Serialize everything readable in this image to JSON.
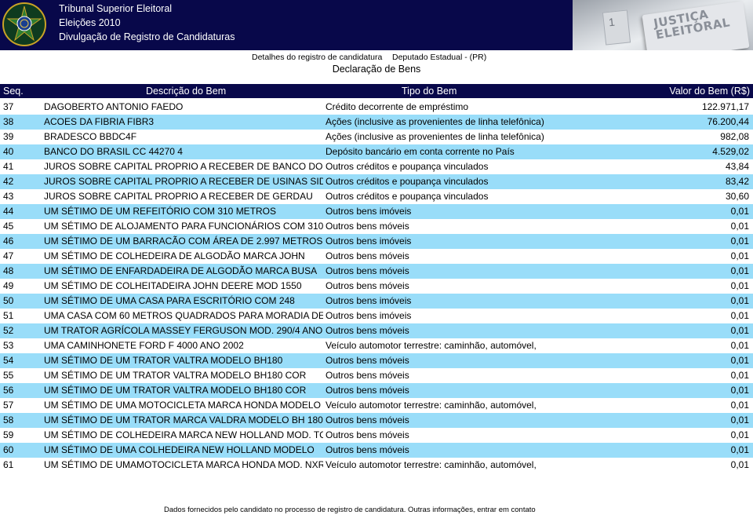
{
  "header": {
    "line1": "Tribunal Superior Eleitoral",
    "line2": "Eleições 2010",
    "line3": "Divulgação de Registro de Candidaturas",
    "photo_text": "JUSTIÇA ELEITORAL",
    "photo_number": "1"
  },
  "subheader": {
    "left": "Detalhes do registro de candidatura",
    "right": "Deputado Estadual - (PR)",
    "title": "Declaração de Bens"
  },
  "table": {
    "columns": {
      "seq": "Seq.",
      "desc": "Descrição do Bem",
      "tipo": "Tipo do Bem",
      "valor": "Valor do Bem (R$)"
    },
    "rows": [
      {
        "seq": "37",
        "desc": "DAGOBERTO ANTONIO FAEDO",
        "tipo": "Crédito decorrente de empréstimo",
        "valor": "122.971,17"
      },
      {
        "seq": "38",
        "desc": "ACOES DA FIBRIA FIBR3",
        "tipo": "Ações (inclusive as provenientes de linha telefônica)",
        "valor": "76.200,44"
      },
      {
        "seq": "39",
        "desc": "BRADESCO BBDC4F",
        "tipo": "Ações (inclusive as provenientes de linha telefônica)",
        "valor": "982,08"
      },
      {
        "seq": "40",
        "desc": "BANCO DO BRASIL CC 44270 4",
        "tipo": "Depósito bancário em conta corrente no País",
        "valor": "4.529,02"
      },
      {
        "seq": "41",
        "desc": "JUROS SOBRE CAPITAL PROPRIO A RECEBER DE BANCO DO",
        "tipo": "Outros créditos e poupança vinculados",
        "valor": "43,84"
      },
      {
        "seq": "42",
        "desc": "JUROS SOBRE CAPITAL PROPRIO A RECEBER DE USINAS SIDE",
        "tipo": "Outros créditos e poupança vinculados",
        "valor": "83,42"
      },
      {
        "seq": "43",
        "desc": "JUROS SOBRE CAPITAL PROPRIO A RECEBER DE GERDAU",
        "tipo": "Outros créditos e poupança vinculados",
        "valor": "30,60"
      },
      {
        "seq": "44",
        "desc": "UM SÉTIMO DE UM REFEITÓRIO COM 310 METROS",
        "tipo": "Outros bens imóveis",
        "valor": "0,01"
      },
      {
        "seq": "45",
        "desc": "UM SÉTIMO DE ALOJAMENTO PARA FUNCIONÁRIOS COM 310",
        "tipo": "Outros bens móveis",
        "valor": "0,01"
      },
      {
        "seq": "46",
        "desc": "UM SÉTIMO DE UM BARRACÃO COM ÁREA DE 2.997 METROS",
        "tipo": "Outros bens imóveis",
        "valor": "0,01"
      },
      {
        "seq": "47",
        "desc": "UM SÉTIMO DE COLHEDEIRA DE ALGODÃO MARCA JOHN",
        "tipo": "Outros bens móveis",
        "valor": "0,01"
      },
      {
        "seq": "48",
        "desc": "UM SÉTIMO DE ENFARDADEIRA DE ALGODÃO MARCA BUSA",
        "tipo": "Outros bens móveis",
        "valor": "0,01"
      },
      {
        "seq": "49",
        "desc": "UM SÉTIMO DE COLHEITADEIRA JOHN DEERE MOD 1550",
        "tipo": "Outros bens móveis",
        "valor": "0,01"
      },
      {
        "seq": "50",
        "desc": "UM SÉTIMO DE UMA CASA PARA ESCRITÓRIO COM 248",
        "tipo": "Outros bens imóveis",
        "valor": "0,01"
      },
      {
        "seq": "51",
        "desc": "UMA CASA COM 60 METROS QUADRADOS PARA MORADIA DE",
        "tipo": "Outros bens imóveis",
        "valor": "0,01"
      },
      {
        "seq": "52",
        "desc": "UM TRATOR AGRÍCOLA MASSEY FERGUSON MOD. 290/4 ANO",
        "tipo": "Outros bens móveis",
        "valor": "0,01"
      },
      {
        "seq": "53",
        "desc": "UMA CAMINHONETE FORD F 4000 ANO 2002",
        "tipo": "Veículo automotor terrestre: caminhão, automóvel,",
        "valor": "0,01"
      },
      {
        "seq": "54",
        "desc": "UM SÉTIMO DE UM TRATOR VALTRA MODELO BH180",
        "tipo": "Outros bens móveis",
        "valor": "0,01"
      },
      {
        "seq": "55",
        "desc": "UM SÉTIMO DE UM TRATOR VALTRA MODELO BH180 COR",
        "tipo": "Outros bens móveis",
        "valor": "0,01"
      },
      {
        "seq": "56",
        "desc": "UM SÉTIMO DE UM TRATOR VALTRA MODELO BH180 COR",
        "tipo": "Outros bens móveis",
        "valor": "0,01"
      },
      {
        "seq": "57",
        "desc": "UM SÉTIMO DE UMA MOTOCICLETA MARCA HONDA MODELO",
        "tipo": "Veículo automotor terrestre: caminhão, automóvel,",
        "valor": "0,01"
      },
      {
        "seq": "58",
        "desc": "UM SÉTIMO DE UM TRATOR MARCA VALDRA MODELO BH 180",
        "tipo": "Outros bens móveis",
        "valor": "0,01"
      },
      {
        "seq": "59",
        "desc": "UM SÉTIMO DE COLHEDEIRA MARCA NEW HOLLAND MOD. TC",
        "tipo": "Outros bens móveis",
        "valor": "0,01"
      },
      {
        "seq": "60",
        "desc": "UM SÉTIMO DE UMA COLHEDEIRA NEW HOLLAND MODELO",
        "tipo": "Outros bens móveis",
        "valor": "0,01"
      },
      {
        "seq": "61",
        "desc": "UM SÉTIMO DE UMAMOTOCICLETA MARCA HONDA MOD. NXR",
        "tipo": "Veículo automotor terrestre: caminhão, automóvel,",
        "valor": "0,01"
      }
    ]
  },
  "footer": {
    "text": "Dados fornecidos pelo candidato no processo de registro de candidatura. Outras informações, entrar em contato"
  },
  "colors": {
    "banner": "#08084a",
    "row_alt": "#99ddf9"
  }
}
